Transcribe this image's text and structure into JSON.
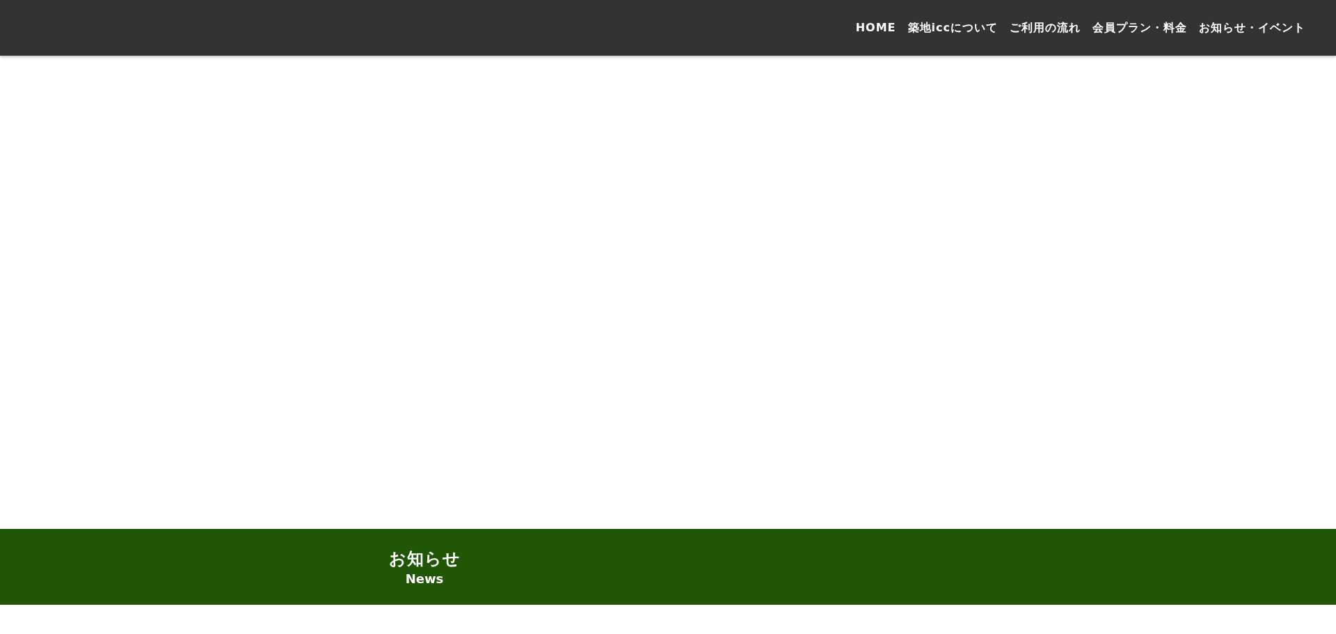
{
  "nav": {
    "items": [
      {
        "label": "HOME"
      },
      {
        "label": "築地iccについて"
      },
      {
        "label": "ご利用の流れ"
      },
      {
        "label": "会員プラン・料金"
      },
      {
        "label": "お知らせ・イベント"
      }
    ]
  },
  "news_banner": {
    "title": "お知らせ",
    "subtitle": "News"
  }
}
